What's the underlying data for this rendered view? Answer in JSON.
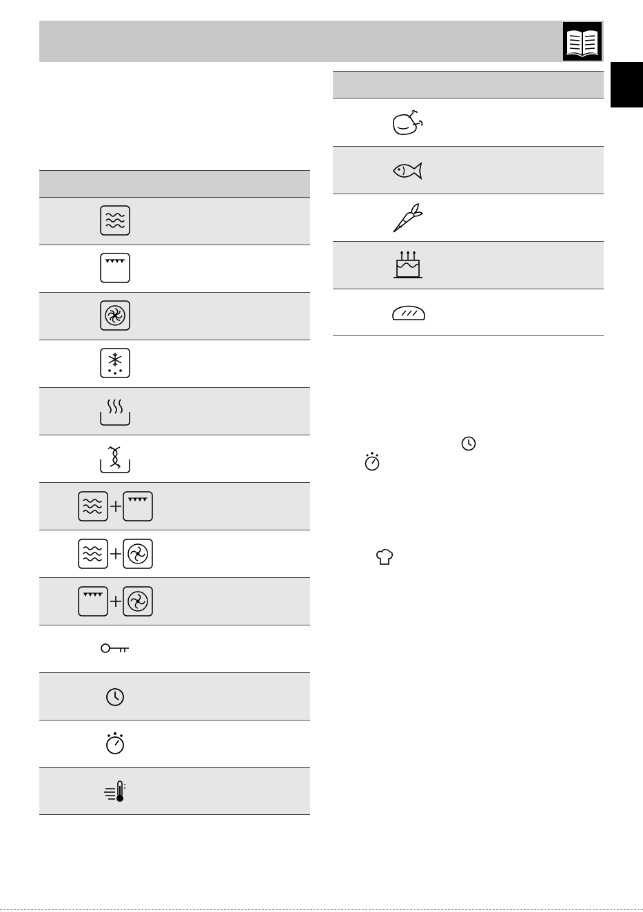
{
  "header": {
    "icon": "open-book-icon",
    "colors": {
      "bar": "#c8c8c8",
      "icon_bg": "#000000",
      "tab": "#000000"
    }
  },
  "functions_table": {
    "rows": [
      {
        "icon": "microwave-icon",
        "shaded": true
      },
      {
        "icon": "grill-icon",
        "shaded": false
      },
      {
        "icon": "fan-assisted-icon",
        "shaded": true
      },
      {
        "icon": "defrost-icon",
        "shaded": false
      },
      {
        "icon": "steam-icon",
        "shaded": true
      },
      {
        "icon": "reheat-icon",
        "shaded": false
      },
      {
        "icon": "microwave-plus-grill-icon",
        "shaded": true
      },
      {
        "icon": "microwave-plus-fan-icon",
        "shaded": false
      },
      {
        "icon": "grill-plus-fan-icon",
        "shaded": true
      },
      {
        "icon": "key-lock-icon",
        "shaded": false
      },
      {
        "icon": "clock-icon",
        "shaded": true
      },
      {
        "icon": "timer-icon",
        "shaded": false
      },
      {
        "icon": "fast-preheat-icon",
        "shaded": true
      }
    ]
  },
  "food_table": {
    "rows": [
      {
        "icon": "poultry-icon",
        "shaded": false
      },
      {
        "icon": "fish-icon",
        "shaded": true
      },
      {
        "icon": "vegetables-icon",
        "shaded": false
      },
      {
        "icon": "cake-icon",
        "shaded": true
      },
      {
        "icon": "bread-icon",
        "shaded": false
      }
    ]
  },
  "inline_icons": [
    "clock-icon",
    "timer-icon",
    "chef-hat-icon"
  ]
}
